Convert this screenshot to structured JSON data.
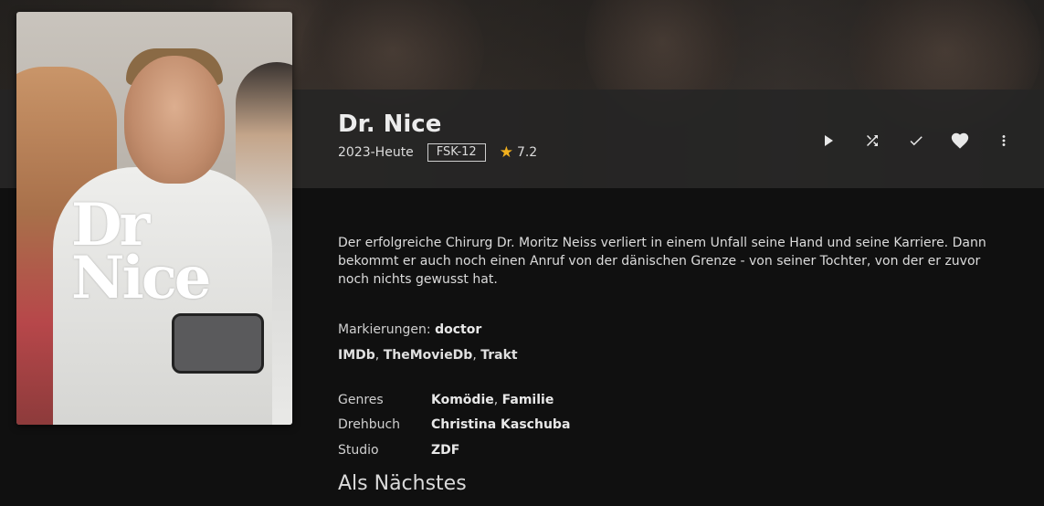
{
  "item": {
    "title": "Dr. Nice",
    "year": "2023-Heute",
    "age_rating": "FSK-12",
    "community_rating": "7.2",
    "poster_title_line1": "Dr",
    "poster_title_line2": "Nice"
  },
  "actions": [
    {
      "name": "play",
      "icon": "play-icon"
    },
    {
      "name": "shuffle",
      "icon": "shuffle-icon"
    },
    {
      "name": "mark-played",
      "icon": "check-icon"
    },
    {
      "name": "favorite",
      "icon": "heart-icon"
    },
    {
      "name": "more",
      "icon": "more-vertical-icon"
    }
  ],
  "overview": "Der erfolgreiche Chirurg Dr. Moritz Neiss verliert in einem Unfall seine Hand und seine Karriere. Dann bekommt er auch noch einen Anruf von der dänischen Grenze - von seiner Tochter, von der er zuvor noch nichts gewusst hat.",
  "tags": {
    "label": "Markierungen:",
    "values": [
      "doctor"
    ]
  },
  "links": [
    "IMDb",
    "TheMovieDb",
    "Trakt"
  ],
  "details": {
    "genres_label": "Genres",
    "genres": [
      "Komödie",
      "Familie"
    ],
    "writer_label": "Drehbuch",
    "writer": "Christina Kaschuba",
    "studio_label": "Studio",
    "studio": "ZDF"
  },
  "next_up_heading": "Als Nächstes",
  "colors": {
    "accent_star": "#f2b01e",
    "background": "#101010",
    "header_band": "#242424"
  }
}
